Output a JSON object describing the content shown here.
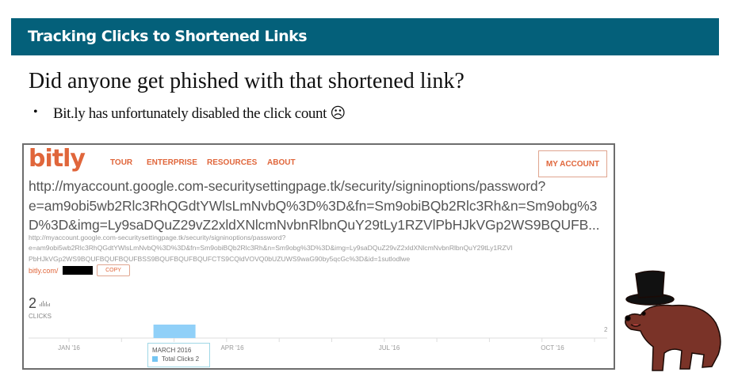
{
  "slide": {
    "title": "Tracking Clicks to Shortened Links",
    "heading": "Did anyone get phished with that shortened link?",
    "bullet_marker": "•",
    "bullet": "Bit.ly has unfortunately disabled the click count ☹",
    "header_color": "#04607a"
  },
  "bitly": {
    "logo": "bitly",
    "nav": [
      "TOUR",
      "ENTERPRISE",
      "RESOURCES",
      "ABOUT"
    ],
    "account_button": "MY ACCOUNT",
    "long_url_lines": [
      "http://myaccount.google.com-securitysettingpage.tk/security/signinoptions/password?",
      "e=am9obi5wb2Rlc3RhQGdtYWlsLmNvbQ%3D%3D&fn=Sm9obiBQb2Rlc3Rh&n=Sm9obg%3",
      "D%3D&img=Ly9saDQuZ29vZ2xldXNlcmNvbnRlbnQuY29tLy1RZVlPbHJkVGp2WS9BQUFB..."
    ],
    "full_url_lines": [
      "http://myaccount.google.com-securitysettingpage.tk/security/signinoptions/password?",
      "e=am9obi5wb2Rlc3RhQGdtYWlsLmNvbQ%3D%3D&fn=Sm9obiBQb2Rlc3Rh&n=Sm9obg%3D%3D&img=Ly9saDQuZ29vZ2xldXNlcmNvbnRlbnQuY29tLy1RZVl",
      "PbHJkVGp2WS9BQUFBQUFBQUFBSS9BQUFBQUFBQUFCTS9CQldVOVQ0bUZUWS9waG90by5qcGc%3D&id=1sutlodlwe"
    ],
    "short_link_prefix": "bitly.com/",
    "copy_button": "COPY",
    "click_count": "2",
    "clicks_label": "CLICKS",
    "accent": "#e0663b"
  },
  "chart_data": {
    "type": "bar",
    "x_tick_labels": [
      "JAN '16",
      "APR '16",
      "JUL '16",
      "OCT '16"
    ],
    "categories": [
      "Mar 2016"
    ],
    "values": [
      2
    ],
    "y_max_label": "2",
    "bar_color": "#90d0f8",
    "tooltip": {
      "title": "MARCH 2016",
      "series": "Total Clicks",
      "value": "2",
      "label": "Total Clicks 2"
    }
  }
}
